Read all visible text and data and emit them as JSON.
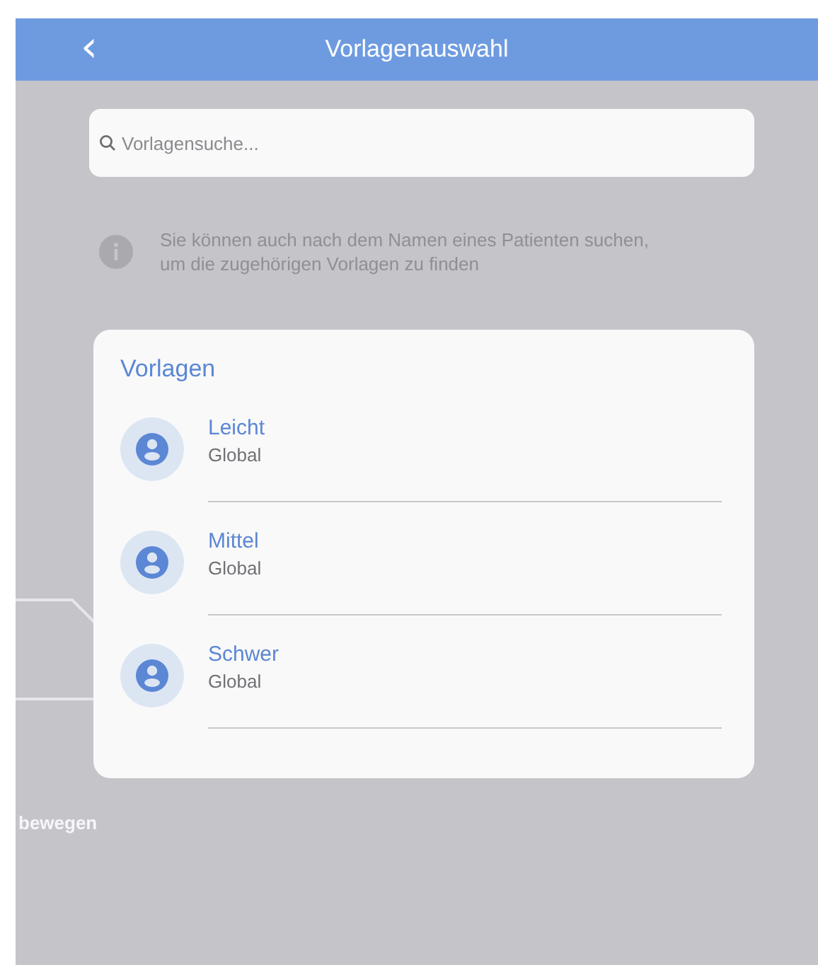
{
  "header": {
    "back_icon": "‹",
    "title": "Vorlagenauswahl"
  },
  "search": {
    "placeholder": "Vorlagensuche..."
  },
  "info": {
    "text": "Sie können auch nach dem Namen eines Patienten suchen, um die zugehörigen Vorlagen zu finden"
  },
  "templates": {
    "title": "Vorlagen",
    "items": [
      {
        "name": "Leicht",
        "scope": "Global"
      },
      {
        "name": "Mittel",
        "scope": "Global"
      },
      {
        "name": "Schwer",
        "scope": "Global"
      }
    ]
  },
  "background_label": "bewegen"
}
